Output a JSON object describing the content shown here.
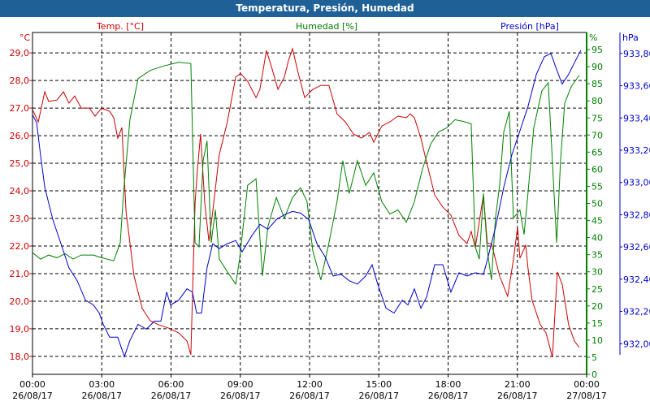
{
  "window": {
    "title": "Temperatura, Presión, Humedad"
  },
  "chart_data": {
    "type": "line",
    "title": "Temperatura, Presión, Humedad",
    "xlabel": "",
    "x_unit": "hours since 26/08/17 00:00",
    "xlim": [
      0,
      24
    ],
    "x_ticks": [
      {
        "t": "00:00",
        "d": "26/08/17"
      },
      {
        "t": "03:00",
        "d": "26/08/17"
      },
      {
        "t": "06:00",
        "d": "26/08/17"
      },
      {
        "t": "09:00",
        "d": "26/08/17"
      },
      {
        "t": "12:00",
        "d": "26/08/17"
      },
      {
        "t": "15:00",
        "d": "26/08/17"
      },
      {
        "t": "18:00",
        "d": "26/08/17"
      },
      {
        "t": "21:00",
        "d": "26/08/17"
      },
      {
        "t": "00:00",
        "d": "27/08/17"
      }
    ],
    "axes": {
      "temp": {
        "label": "°C",
        "legend": "Temp. [°C]",
        "color": "#cc0000",
        "ylim": [
          17.35,
          29.74
        ],
        "ticks": [
          "18,0",
          "19,0",
          "20,0",
          "21,0",
          "22,0",
          "23,0",
          "24,0",
          "25,0",
          "26,0",
          "27,0",
          "28,0",
          "29,0"
        ]
      },
      "hum": {
        "label": "%",
        "legend": "Humedad [%]",
        "color": "#008000",
        "ylim": [
          0,
          100
        ],
        "ticks": [
          "0",
          "5",
          "10",
          "15",
          "20",
          "25",
          "30",
          "35",
          "40",
          "45",
          "50",
          "55",
          "60",
          "65",
          "70",
          "75",
          "80",
          "85",
          "90",
          "95"
        ]
      },
      "pres": {
        "label": "hPa",
        "legend": "Presión [hPa]",
        "color": "#0000cc",
        "ylim": [
          931.81,
          933.93
        ],
        "ticks": [
          "932,00",
          "932,20",
          "932,40",
          "932,60",
          "932,80",
          "933,00",
          "933,20",
          "933,40",
          "933,60",
          "933,80"
        ]
      }
    },
    "series": [
      {
        "name": "Temp. [°C]",
        "axis": "temp",
        "color": "#cc0000",
        "points": [
          [
            0,
            26.94
          ],
          [
            0.25,
            26.5
          ],
          [
            0.53,
            27.59
          ],
          [
            0.7,
            27.24
          ],
          [
            1.06,
            27.29
          ],
          [
            1.34,
            27.59
          ],
          [
            1.58,
            27.18
          ],
          [
            1.83,
            27.44
          ],
          [
            2.11,
            27.0
          ],
          [
            2.46,
            27.0
          ],
          [
            2.71,
            26.71
          ],
          [
            2.99,
            27.0
          ],
          [
            3.34,
            26.88
          ],
          [
            3.52,
            26.65
          ],
          [
            3.69,
            25.91
          ],
          [
            3.87,
            26.29
          ],
          [
            4.05,
            23.26
          ],
          [
            4.4,
            20.91
          ],
          [
            4.75,
            19.74
          ],
          [
            5.1,
            19.29
          ],
          [
            5.45,
            19.15
          ],
          [
            5.98,
            19.0
          ],
          [
            6.33,
            18.85
          ],
          [
            6.69,
            18.56
          ],
          [
            6.86,
            18.06
          ],
          [
            7.04,
            23.56
          ],
          [
            7.14,
            24.74
          ],
          [
            7.28,
            26.06
          ],
          [
            7.46,
            23.56
          ],
          [
            7.64,
            22.18
          ],
          [
            7.81,
            23.26
          ],
          [
            8.09,
            25.32
          ],
          [
            8.44,
            26.5
          ],
          [
            8.8,
            28.12
          ],
          [
            9.01,
            28.26
          ],
          [
            9.32,
            27.97
          ],
          [
            9.68,
            27.38
          ],
          [
            9.85,
            27.68
          ],
          [
            10.13,
            29.09
          ],
          [
            10.38,
            28.41
          ],
          [
            10.63,
            27.68
          ],
          [
            10.91,
            28.12
          ],
          [
            11.08,
            28.71
          ],
          [
            11.26,
            29.15
          ],
          [
            11.51,
            28.26
          ],
          [
            11.79,
            27.38
          ],
          [
            12.14,
            27.68
          ],
          [
            12.49,
            27.82
          ],
          [
            12.84,
            27.82
          ],
          [
            13.19,
            26.79
          ],
          [
            13.55,
            26.5
          ],
          [
            13.9,
            26.06
          ],
          [
            14.25,
            25.91
          ],
          [
            14.6,
            26.12
          ],
          [
            14.78,
            25.76
          ],
          [
            15.13,
            26.35
          ],
          [
            15.48,
            26.5
          ],
          [
            15.83,
            26.71
          ],
          [
            16.19,
            26.65
          ],
          [
            16.36,
            26.79
          ],
          [
            16.54,
            26.65
          ],
          [
            16.82,
            25.91
          ],
          [
            17.07,
            25.03
          ],
          [
            17.42,
            23.85
          ],
          [
            17.77,
            23.41
          ],
          [
            18.12,
            23.12
          ],
          [
            18.47,
            22.38
          ],
          [
            18.82,
            22.09
          ],
          [
            19.0,
            22.53
          ],
          [
            19.18,
            21.94
          ],
          [
            19.53,
            23.85
          ],
          [
            19.7,
            22.09
          ],
          [
            19.88,
            22.09
          ],
          [
            20.23,
            20.91
          ],
          [
            20.58,
            20.18
          ],
          [
            20.83,
            21.5
          ],
          [
            21.01,
            22.68
          ],
          [
            21.11,
            21.56
          ],
          [
            21.36,
            22.03
          ],
          [
            21.46,
            21.21
          ],
          [
            21.64,
            20.03
          ],
          [
            21.99,
            19.15
          ],
          [
            22.24,
            18.85
          ],
          [
            22.52,
            17.97
          ],
          [
            22.73,
            21.06
          ],
          [
            22.94,
            20.62
          ],
          [
            23.22,
            19.15
          ],
          [
            23.47,
            18.56
          ],
          [
            23.68,
            18.32
          ]
        ]
      },
      {
        "name": "Humedad [%]",
        "axis": "hum",
        "color": "#008000",
        "points": [
          [
            0,
            35.6
          ],
          [
            0.35,
            33.7
          ],
          [
            0.7,
            34.9
          ],
          [
            1.06,
            34.1
          ],
          [
            1.41,
            35.3
          ],
          [
            1.76,
            33.7
          ],
          [
            2.11,
            34.9
          ],
          [
            2.64,
            34.9
          ],
          [
            2.99,
            34.1
          ],
          [
            3.52,
            33.2
          ],
          [
            3.8,
            38.5
          ],
          [
            3.94,
            52.9
          ],
          [
            4.22,
            74.5
          ],
          [
            4.57,
            86.5
          ],
          [
            5.1,
            88.9
          ],
          [
            5.63,
            90.1
          ],
          [
            6.33,
            91.3
          ],
          [
            6.86,
            90.9
          ],
          [
            7.04,
            38.5
          ],
          [
            7.21,
            37.3
          ],
          [
            7.39,
            62.5
          ],
          [
            7.56,
            68.3
          ],
          [
            7.74,
            38.5
          ],
          [
            7.92,
            48.1
          ],
          [
            8.09,
            33.7
          ],
          [
            8.44,
            30.0
          ],
          [
            8.8,
            26.4
          ],
          [
            8.97,
            33.7
          ],
          [
            9.32,
            55.3
          ],
          [
            9.68,
            57.2
          ],
          [
            9.96,
            28.8
          ],
          [
            10.2,
            43.3
          ],
          [
            10.56,
            51.7
          ],
          [
            10.91,
            45.7
          ],
          [
            11.26,
            51.7
          ],
          [
            11.61,
            54.6
          ],
          [
            11.89,
            50.5
          ],
          [
            12.14,
            36.1
          ],
          [
            12.49,
            27.6
          ],
          [
            12.84,
            38.5
          ],
          [
            13.19,
            50.5
          ],
          [
            13.44,
            62.5
          ],
          [
            13.72,
            52.9
          ],
          [
            14.07,
            62.5
          ],
          [
            14.43,
            55.3
          ],
          [
            14.78,
            58.9
          ],
          [
            15.13,
            50.5
          ],
          [
            15.48,
            46.9
          ],
          [
            15.83,
            48.1
          ],
          [
            16.19,
            44.5
          ],
          [
            16.54,
            50.5
          ],
          [
            16.89,
            60.1
          ],
          [
            17.24,
            67.3
          ],
          [
            17.59,
            70.9
          ],
          [
            17.94,
            72.1
          ],
          [
            18.3,
            74.5
          ],
          [
            18.65,
            74.0
          ],
          [
            19.0,
            73.3
          ],
          [
            19.18,
            37.3
          ],
          [
            19.35,
            33.7
          ],
          [
            19.53,
            52.9
          ],
          [
            19.7,
            36.1
          ],
          [
            19.88,
            27.6
          ],
          [
            20.05,
            45.7
          ],
          [
            20.23,
            55.3
          ],
          [
            20.41,
            70.9
          ],
          [
            20.65,
            76.9
          ],
          [
            20.83,
            45.7
          ],
          [
            21.11,
            48.1
          ],
          [
            21.29,
            40.9
          ],
          [
            21.46,
            52.9
          ],
          [
            21.71,
            72.1
          ],
          [
            22.06,
            82.9
          ],
          [
            22.34,
            85.3
          ],
          [
            22.7,
            38.5
          ],
          [
            22.87,
            62.5
          ],
          [
            23.05,
            79.3
          ],
          [
            23.33,
            84.1
          ],
          [
            23.68,
            87.5
          ]
        ]
      },
      {
        "name": "Presión [hPa]",
        "axis": "pres",
        "color": "#0000cc",
        "points": [
          [
            0,
            933.42
          ],
          [
            0.18,
            933.37
          ],
          [
            0.35,
            933.17
          ],
          [
            0.53,
            932.97
          ],
          [
            0.88,
            932.77
          ],
          [
            1.23,
            932.62
          ],
          [
            1.58,
            932.47
          ],
          [
            1.94,
            932.39
          ],
          [
            2.29,
            932.27
          ],
          [
            2.64,
            932.24
          ],
          [
            2.89,
            932.19
          ],
          [
            3.06,
            932.12
          ],
          [
            3.34,
            932.04
          ],
          [
            3.69,
            932.04
          ],
          [
            3.98,
            931.92
          ],
          [
            4.22,
            932.02
          ],
          [
            4.57,
            932.12
          ],
          [
            4.93,
            932.09
          ],
          [
            5.28,
            932.14
          ],
          [
            5.56,
            932.14
          ],
          [
            5.81,
            932.32
          ],
          [
            5.98,
            932.24
          ],
          [
            6.33,
            932.27
          ],
          [
            6.69,
            932.34
          ],
          [
            6.93,
            932.32
          ],
          [
            7.11,
            932.19
          ],
          [
            7.32,
            932.19
          ],
          [
            7.56,
            932.47
          ],
          [
            7.81,
            932.62
          ],
          [
            8.09,
            932.59
          ],
          [
            8.44,
            932.62
          ],
          [
            8.8,
            932.64
          ],
          [
            9.08,
            932.57
          ],
          [
            9.5,
            932.67
          ],
          [
            9.85,
            932.74
          ],
          [
            10.2,
            932.71
          ],
          [
            10.56,
            932.77
          ],
          [
            10.91,
            932.8
          ],
          [
            11.26,
            932.82
          ],
          [
            11.61,
            932.81
          ],
          [
            11.96,
            932.77
          ],
          [
            12.32,
            932.62
          ],
          [
            12.67,
            932.54
          ],
          [
            13.02,
            932.42
          ],
          [
            13.37,
            932.43
          ],
          [
            13.72,
            932.39
          ],
          [
            14.07,
            932.37
          ],
          [
            14.43,
            932.42
          ],
          [
            14.71,
            932.49
          ],
          [
            14.95,
            932.37
          ],
          [
            15.31,
            932.22
          ],
          [
            15.66,
            932.19
          ],
          [
            16.01,
            932.27
          ],
          [
            16.26,
            932.24
          ],
          [
            16.54,
            932.34
          ],
          [
            16.82,
            932.22
          ],
          [
            17.07,
            932.29
          ],
          [
            17.42,
            932.49
          ],
          [
            17.77,
            932.49
          ],
          [
            18.12,
            932.32
          ],
          [
            18.47,
            932.44
          ],
          [
            18.82,
            932.42
          ],
          [
            19.18,
            932.44
          ],
          [
            19.53,
            932.43
          ],
          [
            19.7,
            932.52
          ],
          [
            20.05,
            932.72
          ],
          [
            20.41,
            932.97
          ],
          [
            20.76,
            933.17
          ],
          [
            21.11,
            933.32
          ],
          [
            21.46,
            933.47
          ],
          [
            21.82,
            933.67
          ],
          [
            22.17,
            933.78
          ],
          [
            22.45,
            933.8
          ],
          [
            22.7,
            933.7
          ],
          [
            22.94,
            933.61
          ],
          [
            23.22,
            933.67
          ],
          [
            23.5,
            933.75
          ],
          [
            23.75,
            933.82
          ]
        ]
      }
    ]
  }
}
